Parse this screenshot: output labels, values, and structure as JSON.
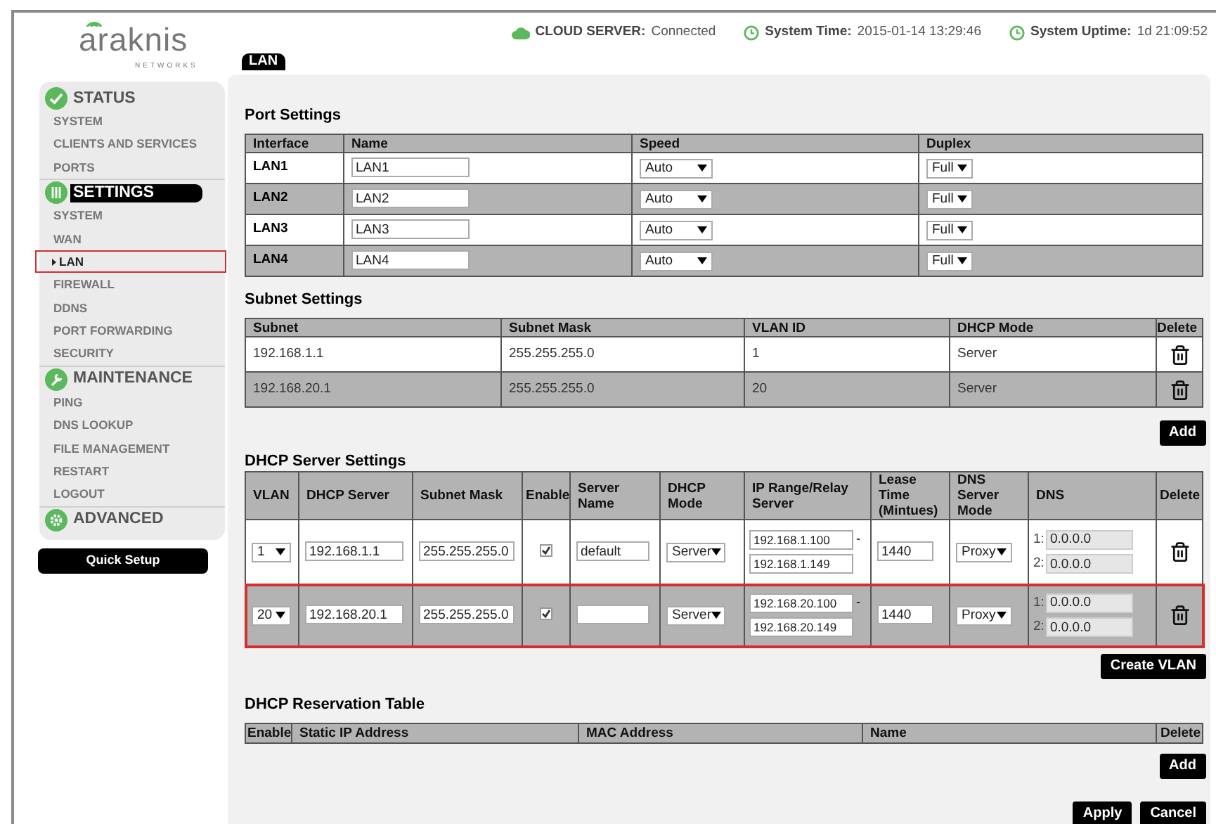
{
  "logo": {
    "name": "araknis",
    "tagline": "NETWORKS"
  },
  "status_bar": [
    {
      "kind": "cloud",
      "label": "CLOUD SERVER:",
      "value": "Connected"
    },
    {
      "kind": "clock",
      "label": "System Time:",
      "value": "2015-01-14 13:29:46"
    },
    {
      "kind": "clock",
      "label": "System Uptime:",
      "value": "1d 21:09:52"
    }
  ],
  "page_tab": "LAN",
  "sidebar": {
    "sections": [
      {
        "title": "STATUS",
        "selected": false,
        "items": [
          {
            "label": "SYSTEM",
            "selected": false
          },
          {
            "label": "CLIENTS AND SERVICES",
            "selected": false
          },
          {
            "label": "PORTS",
            "selected": false
          }
        ]
      },
      {
        "title": "SETTINGS",
        "selected": true,
        "items": [
          {
            "label": "SYSTEM",
            "selected": false
          },
          {
            "label": "WAN",
            "selected": false
          },
          {
            "label": "LAN",
            "selected": true
          },
          {
            "label": "FIREWALL",
            "selected": false
          },
          {
            "label": "DDNS",
            "selected": false
          },
          {
            "label": "PORT FORWARDING",
            "selected": false
          },
          {
            "label": "SECURITY",
            "selected": false
          }
        ]
      },
      {
        "title": "MAINTENANCE",
        "selected": false,
        "items": [
          {
            "label": "PING",
            "selected": false
          },
          {
            "label": "DNS LOOKUP",
            "selected": false
          },
          {
            "label": "FILE MANAGEMENT",
            "selected": false
          },
          {
            "label": "RESTART",
            "selected": false
          },
          {
            "label": "LOGOUT",
            "selected": false
          }
        ]
      },
      {
        "title": "ADVANCED",
        "selected": false
      }
    ],
    "quick_setup_button": "Quick Setup"
  },
  "port_settings": {
    "title": "Port Settings",
    "columns": [
      "Interface",
      "Name",
      "Speed",
      "Duplex"
    ],
    "rows": [
      {
        "interface": "LAN1",
        "name": "LAN1",
        "speed": "Auto",
        "duplex": "Full"
      },
      {
        "interface": "LAN2",
        "name": "LAN2",
        "speed": "Auto",
        "duplex": "Full"
      },
      {
        "interface": "LAN3",
        "name": "LAN3",
        "speed": "Auto",
        "duplex": "Full"
      },
      {
        "interface": "LAN4",
        "name": "LAN4",
        "speed": "Auto",
        "duplex": "Full"
      }
    ]
  },
  "subnet_settings": {
    "title": "Subnet Settings",
    "columns": [
      "Subnet",
      "Subnet Mask",
      "VLAN ID",
      "DHCP Mode",
      "Delete"
    ],
    "rows": [
      {
        "subnet": "192.168.1.1",
        "mask": "255.255.255.0",
        "vlan_id": "1",
        "dhcp_mode": "Server"
      },
      {
        "subnet": "192.168.20.1",
        "mask": "255.255.255.0",
        "vlan_id": "20",
        "dhcp_mode": "Server"
      }
    ],
    "add_button": "Add"
  },
  "dhcp_server_settings": {
    "title": "DHCP Server Settings",
    "columns": [
      "VLAN",
      "DHCP Server",
      "Subnet Mask",
      "Enable",
      "Server Name",
      "DHCP Mode",
      "IP Range/Relay Server",
      "Lease Time (Mintues)",
      "DNS Server Mode",
      "DNS",
      "Delete"
    ],
    "rows": [
      {
        "vlan": "1",
        "dhcp_server": "192.168.1.1",
        "subnet_mask": "255.255.255.0",
        "enabled": true,
        "server_name": "default",
        "dhcp_mode": "Server",
        "ip_start": "192.168.1.100",
        "range_separator": "-",
        "ip_end": "192.168.1.149",
        "lease": "1440",
        "dns_mode": "Proxy",
        "dns": [
          {
            "label": "1:",
            "value": "0.0.0.0"
          },
          {
            "label": "2:",
            "value": "0.0.0.0"
          }
        ],
        "highlighted": false
      },
      {
        "vlan": "20",
        "dhcp_server": "192.168.20.1",
        "subnet_mask": "255.255.255.0",
        "enabled": true,
        "dhcp_mode": "Server",
        "ip_start": "192.168.20.100",
        "range_separator": "-",
        "ip_end": "192.168.20.149",
        "lease": "1440",
        "dns_mode": "Proxy",
        "dns": [
          {
            "label": "1:",
            "value": "0.0.0.0"
          },
          {
            "label": "2:",
            "value": "0.0.0.0"
          }
        ],
        "highlighted": true
      }
    ],
    "create_button": "Create VLAN"
  },
  "dhcp_reservation_table": {
    "title": "DHCP Reservation Table",
    "columns": [
      "Enable",
      "Static IP Address",
      "MAC Address",
      "Name",
      "Delete"
    ],
    "add_button": "Add"
  },
  "footer_buttons": [
    "Apply",
    "Cancel"
  ]
}
